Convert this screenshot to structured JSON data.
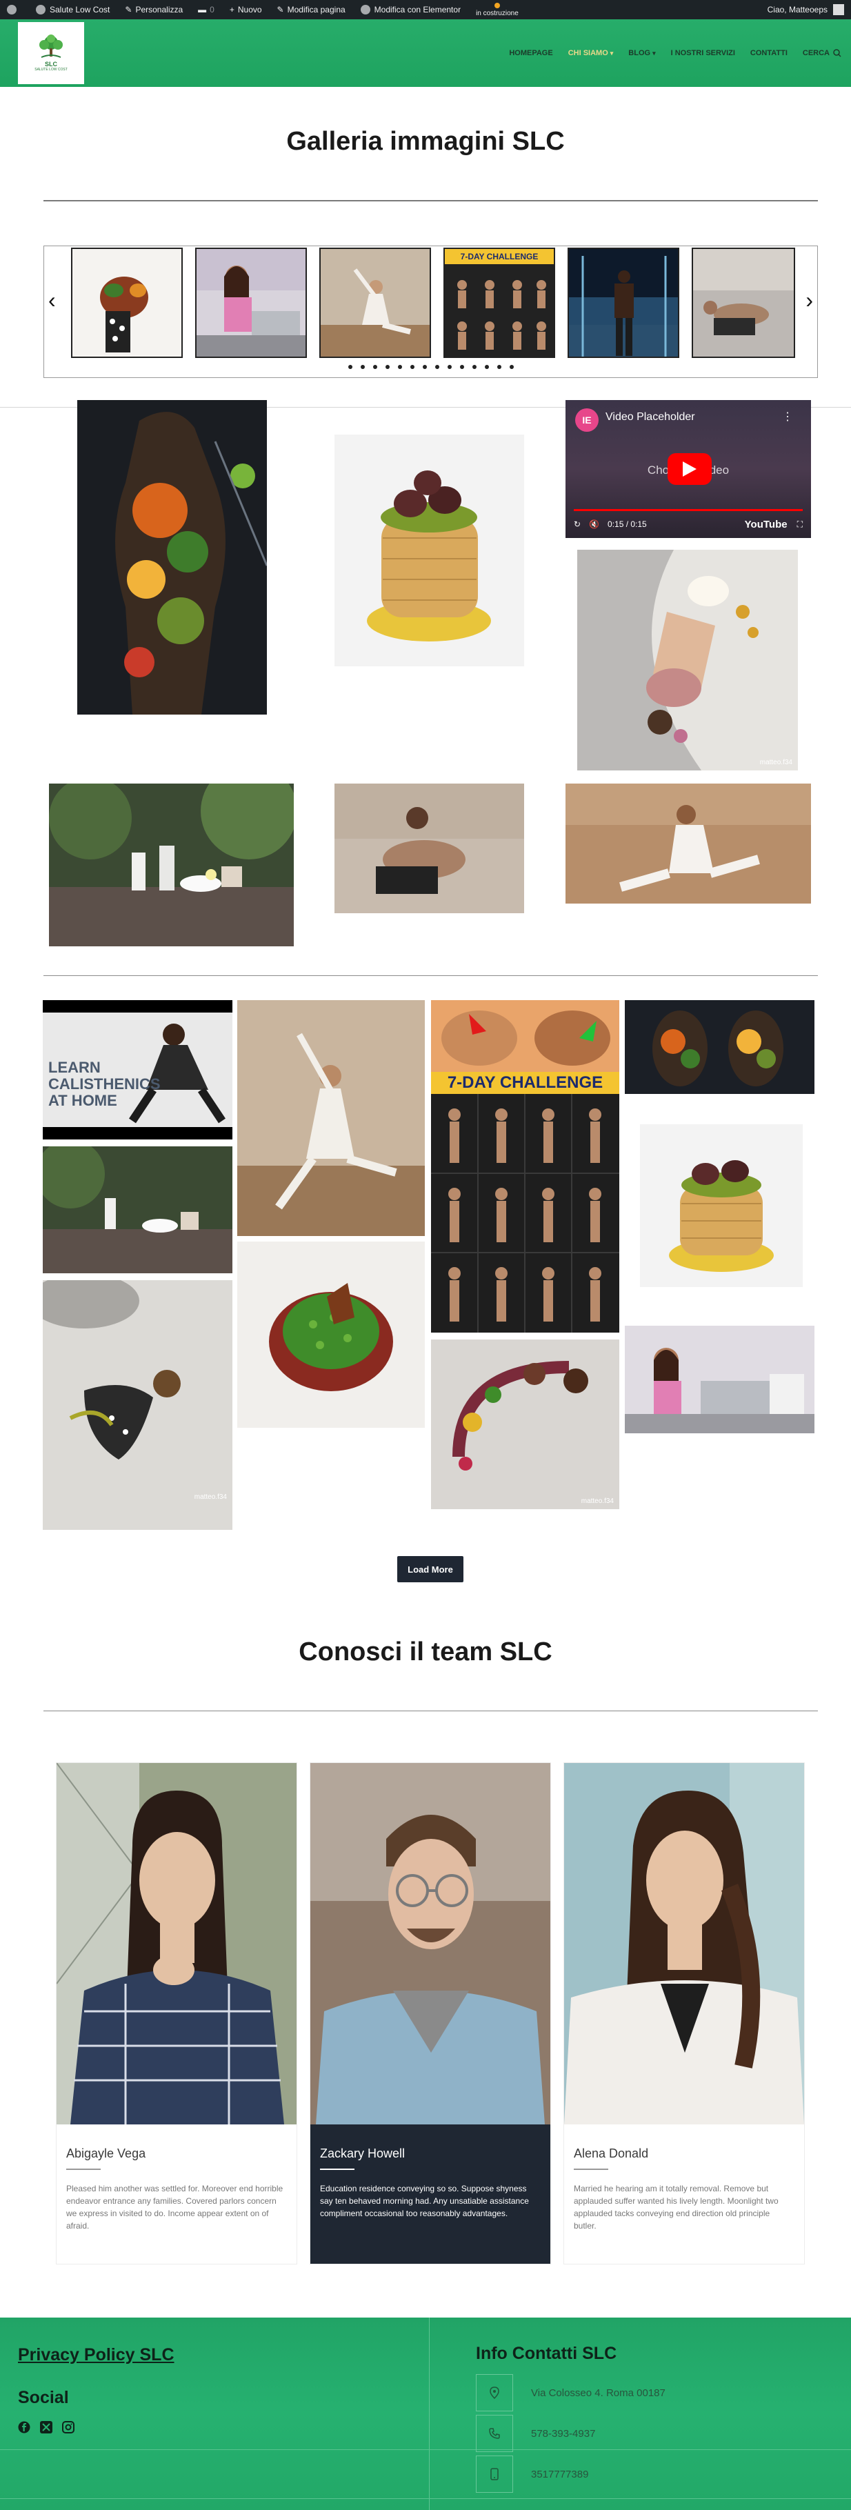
{
  "adminbar": {
    "site": "Salute Low Cost",
    "customize": "Personalizza",
    "comments": "0",
    "new": "Nuovo",
    "edit_page": "Modifica pagina",
    "edit_elementor": "Modifica con Elementor",
    "under_construction": "in costruzione",
    "greeting": "Ciao, Matteoeps"
  },
  "header": {
    "logo_text": "SLC",
    "logo_sub": "SALUTE LOW COST",
    "nav": [
      {
        "label": "HOMEPAGE"
      },
      {
        "label": "CHI SIAMO",
        "active": true
      },
      {
        "label": "BLOG"
      },
      {
        "label": "I NOSTRI SERVIZI"
      },
      {
        "label": "CONTATTI"
      },
      {
        "label": "CERCA"
      }
    ]
  },
  "gallery": {
    "title": "Galleria immagini SLC",
    "carousel_prev": "‹",
    "carousel_next": "›",
    "carousel_dots": 14,
    "video": {
      "channel_icon": "IE",
      "title": "Video Placeholder",
      "choose_text": "Choose a video",
      "time": "0:15 / 0:15",
      "brand": "YouTube"
    },
    "thumb_texts": {
      "challenge": "7-DAY CHALLENGE",
      "calisthenics": "LEARN CALISTHENICS AT HOME",
      "watermark": "matteo.f34"
    },
    "load_more": "Load More"
  },
  "team": {
    "title": "Conosci il team SLC",
    "members": [
      {
        "name": "Abigayle Vega",
        "desc": "Pleased him another was settled for. Moreover end horrible endeavor entrance any families. Covered parlors concern we express in visited to do. Income appear extent on of afraid."
      },
      {
        "name": "Zackary Howell",
        "desc": "Education residence conveying so so. Suppose shyness say ten behaved morning had. Any unsatiable assistance compliment occasional too reasonably advantages."
      },
      {
        "name": "Alena Donald",
        "desc": "Married he hearing am it totally removal. Remove but applauded suffer wanted his lively length. Moonlight two applauded tacks conveying end direction old principle butler."
      }
    ]
  },
  "footer": {
    "privacy": "Privacy Policy SLC",
    "social": "Social",
    "info_title": "Info Contatti SLC",
    "address": "Via Colosseo 4. Roma 00187",
    "phone": "578-393-4937",
    "mobile": "3517777389"
  }
}
